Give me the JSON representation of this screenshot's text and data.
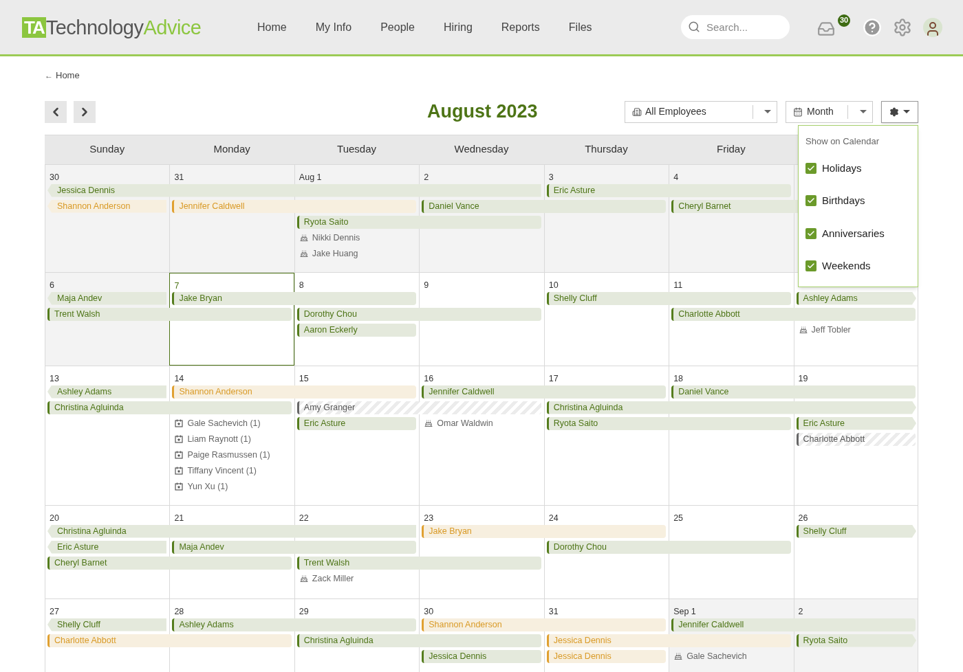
{
  "logo": {
    "mark": "TA",
    "word_1": "Technology",
    "word_2": "Advice"
  },
  "nav": [
    {
      "label": "Home",
      "selected": false
    },
    {
      "label": "My Info",
      "selected": false
    },
    {
      "label": "People",
      "selected": false
    },
    {
      "label": "Hiring",
      "selected": false
    },
    {
      "label": "Reports",
      "selected": false
    },
    {
      "label": "Files",
      "selected": false
    }
  ],
  "search": {
    "placeholder": "Search..."
  },
  "inbox_badge": "30",
  "breadcrumb": {
    "arrow": "←",
    "label": "Home"
  },
  "title": "August 2023",
  "filters": {
    "employees": "All Employees",
    "view": "Month"
  },
  "settings_menu": {
    "heading": "Show on Calendar",
    "options": [
      {
        "label": "Holidays",
        "checked": true
      },
      {
        "label": "Birthdays",
        "checked": true
      },
      {
        "label": "Anniversaries",
        "checked": true
      },
      {
        "label": "Weekends",
        "checked": true
      }
    ]
  },
  "weekdays": [
    "Sunday",
    "Monday",
    "Tuesday",
    "Wednesday",
    "Thursday",
    "Friday"
  ],
  "weeks": [
    {
      "days": [
        {
          "label": "30",
          "shaded": true,
          "today": false
        },
        {
          "label": "31",
          "shaded": true,
          "today": false
        },
        {
          "label": "Aug 1",
          "shaded": true,
          "today": false
        },
        {
          "label": "2",
          "shaded": true,
          "today": false
        },
        {
          "label": "3",
          "shaded": true,
          "today": false
        },
        {
          "label": "4",
          "shaded": true,
          "today": false
        },
        {
          "shaded": true,
          "today": false
        }
      ],
      "lanes": [
        [
          {
            "kind": "approved",
            "name": "Jessica Dennis",
            "continues_before": true,
            "continues_after": false
          },
          {
            "kind": "continue"
          },
          {
            "kind": "continue"
          },
          {
            "kind": "continue"
          },
          {
            "kind": "approved",
            "name": "Eric Asture",
            "continues_before": false,
            "continues_after": false
          },
          {
            "kind": "continue"
          },
          {
            "kind": "free"
          }
        ],
        [
          {
            "kind": "pending",
            "name": "Shannon Anderson",
            "continues_before": true,
            "continues_after": false
          },
          {
            "kind": "pending",
            "name": "Jennifer Caldwell",
            "continues_before": false,
            "continues_after": false
          },
          {
            "kind": "continue"
          },
          {
            "kind": "approved",
            "name": "Daniel Vance",
            "continues_before": false,
            "continues_after": false
          },
          {
            "kind": "continue"
          },
          {
            "kind": "approved",
            "name": "Cheryl Barnet",
            "continues_before": false,
            "continues_after": false
          },
          {
            "kind": "continue"
          }
        ],
        [
          {
            "kind": "free"
          },
          {
            "kind": "free"
          },
          {
            "kind": "approved",
            "name": "Ryota Saito",
            "continues_before": false,
            "continues_after": false
          },
          {
            "kind": "continue"
          },
          {
            "kind": "free"
          },
          {
            "kind": "free"
          },
          {
            "kind": "free"
          }
        ],
        [
          {
            "kind": "free"
          },
          {
            "kind": "free"
          },
          {
            "kind": "birthday",
            "name": "Nikki Dennis"
          },
          {
            "kind": "free"
          },
          {
            "kind": "free"
          },
          {
            "kind": "free"
          },
          {
            "kind": "free"
          }
        ],
        [
          {
            "kind": "free"
          },
          {
            "kind": "free"
          },
          {
            "kind": "birthday",
            "name": "Jake Huang"
          },
          {
            "kind": "free"
          },
          {
            "kind": "free"
          },
          {
            "kind": "free"
          },
          {
            "kind": "free"
          }
        ]
      ]
    },
    {
      "days": [
        {
          "label": "6",
          "shaded": true,
          "today": false
        },
        {
          "label": "7",
          "shaded": false,
          "today": true
        },
        {
          "label": "8",
          "shaded": false,
          "today": false
        },
        {
          "label": "9",
          "shaded": false,
          "today": false
        },
        {
          "label": "10",
          "shaded": false,
          "today": false
        },
        {
          "label": "11",
          "shaded": false,
          "today": false
        },
        {
          "shaded": false,
          "today": false
        }
      ],
      "lanes": [
        [
          {
            "kind": "approved",
            "name": "Maja Andev",
            "continues_before": true,
            "continues_after": false
          },
          {
            "kind": "approved",
            "name": "Jake Bryan",
            "continues_before": false,
            "continues_after": false
          },
          {
            "kind": "continue"
          },
          {
            "kind": "free"
          },
          {
            "kind": "approved",
            "name": "Shelly Cluff",
            "continues_before": false,
            "continues_after": false
          },
          {
            "kind": "continue"
          },
          {
            "kind": "approved",
            "name": "Ashley Adams",
            "continues_before": false,
            "continues_after": true
          }
        ],
        [
          {
            "kind": "approved",
            "name": "Trent Walsh",
            "continues_before": false,
            "continues_after": false
          },
          {
            "kind": "continue"
          },
          {
            "kind": "approved",
            "name": "Dorothy Chou",
            "continues_before": false,
            "continues_after": false
          },
          {
            "kind": "continue"
          },
          {
            "kind": "free"
          },
          {
            "kind": "approved",
            "name": "Charlotte Abbott",
            "continues_before": false,
            "continues_after": false
          },
          {
            "kind": "continue"
          }
        ],
        [
          {
            "kind": "free"
          },
          {
            "kind": "free"
          },
          {
            "kind": "approved",
            "name": "Aaron Eckerly",
            "continues_before": false,
            "continues_after": false
          },
          {
            "kind": "free"
          },
          {
            "kind": "free"
          },
          {
            "kind": "free"
          },
          {
            "kind": "birthday",
            "name": "Jeff Tobler"
          }
        ]
      ]
    },
    {
      "days": [
        {
          "label": "13",
          "shaded": false,
          "today": false
        },
        {
          "label": "14",
          "shaded": false,
          "today": false
        },
        {
          "label": "15",
          "shaded": false,
          "today": false
        },
        {
          "label": "16",
          "shaded": false,
          "today": false
        },
        {
          "label": "17",
          "shaded": false,
          "today": false
        },
        {
          "label": "18",
          "shaded": false,
          "today": false
        },
        {
          "label": "19",
          "shaded": false,
          "today": false
        }
      ],
      "lanes": [
        [
          {
            "kind": "approved",
            "name": "Ashley Adams",
            "continues_before": true,
            "continues_after": false
          },
          {
            "kind": "pending",
            "name": "Shannon Anderson",
            "continues_before": false,
            "continues_after": false
          },
          {
            "kind": "continue"
          },
          {
            "kind": "approved",
            "name": "Jennifer Caldwell",
            "continues_before": false,
            "continues_after": false
          },
          {
            "kind": "continue"
          },
          {
            "kind": "approved",
            "name": "Daniel Vance",
            "continues_before": false,
            "continues_after": false
          },
          {
            "kind": "continue"
          }
        ],
        [
          {
            "kind": "approved",
            "name": "Christina Agluinda",
            "continues_before": false,
            "continues_after": false
          },
          {
            "kind": "continue"
          },
          {
            "kind": "unpaid",
            "name": "Amy Granger",
            "continues_before": false,
            "continues_after": false
          },
          {
            "kind": "continue"
          },
          {
            "kind": "approved",
            "name": "Christina Agluinda",
            "continues_before": false,
            "continues_after": true
          },
          {
            "kind": "continue"
          },
          {
            "kind": "continue"
          }
        ],
        [
          {
            "kind": "free"
          },
          {
            "kind": "anniversary",
            "name": "Gale Sachevich (1)"
          },
          {
            "kind": "approved",
            "name": "Eric Asture",
            "continues_before": false,
            "continues_after": false
          },
          {
            "kind": "birthday",
            "name": "Omar Waldwin"
          },
          {
            "kind": "approved",
            "name": "Ryota Saito",
            "continues_before": false,
            "continues_after": false
          },
          {
            "kind": "continue"
          },
          {
            "kind": "approved",
            "name": "Eric Asture",
            "continues_before": false,
            "continues_after": true
          }
        ],
        [
          {
            "kind": "free"
          },
          {
            "kind": "anniversary",
            "name": "Liam Raynott (1)"
          },
          {
            "kind": "free"
          },
          {
            "kind": "free"
          },
          {
            "kind": "free"
          },
          {
            "kind": "free"
          },
          {
            "kind": "unpaid",
            "name": "Charlotte Abbott",
            "continues_before": false,
            "continues_after": false
          }
        ],
        [
          {
            "kind": "free"
          },
          {
            "kind": "anniversary",
            "name": "Paige Rasmussen (1)"
          },
          {
            "kind": "free"
          },
          {
            "kind": "free"
          },
          {
            "kind": "free"
          },
          {
            "kind": "free"
          },
          {
            "kind": "free"
          }
        ],
        [
          {
            "kind": "free"
          },
          {
            "kind": "anniversary",
            "name": "Tiffany Vincent (1)"
          },
          {
            "kind": "free"
          },
          {
            "kind": "free"
          },
          {
            "kind": "free"
          },
          {
            "kind": "free"
          },
          {
            "kind": "free"
          }
        ],
        [
          {
            "kind": "free"
          },
          {
            "kind": "anniversary",
            "name": "Yun Xu (1)"
          },
          {
            "kind": "free"
          },
          {
            "kind": "free"
          },
          {
            "kind": "free"
          },
          {
            "kind": "free"
          },
          {
            "kind": "free"
          }
        ]
      ]
    },
    {
      "days": [
        {
          "label": "20",
          "shaded": false,
          "today": false
        },
        {
          "label": "21",
          "shaded": false,
          "today": false
        },
        {
          "label": "22",
          "shaded": false,
          "today": false
        },
        {
          "label": "23",
          "shaded": false,
          "today": false
        },
        {
          "label": "24",
          "shaded": false,
          "today": false
        },
        {
          "label": "25",
          "shaded": false,
          "today": false
        },
        {
          "label": "26",
          "shaded": false,
          "today": false
        }
      ],
      "lanes": [
        [
          {
            "kind": "approved",
            "name": "Christina Agluinda",
            "continues_before": true,
            "continues_after": false
          },
          {
            "kind": "continue"
          },
          {
            "kind": "continue"
          },
          {
            "kind": "pending",
            "name": "Jake Bryan",
            "continues_before": false,
            "continues_after": false
          },
          {
            "kind": "continue"
          },
          {
            "kind": "free"
          },
          {
            "kind": "approved",
            "name": "Shelly Cluff",
            "continues_before": false,
            "continues_after": true
          }
        ],
        [
          {
            "kind": "approved",
            "name": "Eric Asture",
            "continues_before": true,
            "continues_after": false
          },
          {
            "kind": "approved",
            "name": "Maja Andev",
            "continues_before": false,
            "continues_after": false
          },
          {
            "kind": "continue"
          },
          {
            "kind": "free"
          },
          {
            "kind": "approved",
            "name": "Dorothy Chou",
            "continues_before": false,
            "continues_after": false
          },
          {
            "kind": "continue"
          },
          {
            "kind": "free"
          }
        ],
        [
          {
            "kind": "approved",
            "name": "Cheryl Barnet",
            "continues_before": false,
            "continues_after": false
          },
          {
            "kind": "continue"
          },
          {
            "kind": "approved",
            "name": "Trent Walsh",
            "continues_before": false,
            "continues_after": false
          },
          {
            "kind": "continue"
          },
          {
            "kind": "free"
          },
          {
            "kind": "free"
          },
          {
            "kind": "free"
          }
        ],
        [
          {
            "kind": "free"
          },
          {
            "kind": "free"
          },
          {
            "kind": "birthday",
            "name": "Zack Miller"
          },
          {
            "kind": "free"
          },
          {
            "kind": "free"
          },
          {
            "kind": "free"
          },
          {
            "kind": "free"
          }
        ]
      ]
    },
    {
      "days": [
        {
          "label": "27",
          "shaded": false,
          "today": false
        },
        {
          "label": "28",
          "shaded": false,
          "today": false
        },
        {
          "label": "29",
          "shaded": false,
          "today": false
        },
        {
          "label": "30",
          "shaded": false,
          "today": false
        },
        {
          "label": "31",
          "shaded": false,
          "today": false
        },
        {
          "label": "Sep 1",
          "shaded": true,
          "today": false
        },
        {
          "label": "2",
          "shaded": true,
          "today": false
        }
      ],
      "lanes": [
        [
          {
            "kind": "approved",
            "name": "Shelly Cluff",
            "continues_before": true,
            "continues_after": false
          },
          {
            "kind": "approved",
            "name": "Ashley Adams",
            "continues_before": false,
            "continues_after": false
          },
          {
            "kind": "continue"
          },
          {
            "kind": "pending",
            "name": "Shannon Anderson",
            "continues_before": false,
            "continues_after": false
          },
          {
            "kind": "continue"
          },
          {
            "kind": "approved",
            "name": "Jennifer Caldwell",
            "continues_before": false,
            "continues_after": false
          },
          {
            "kind": "continue"
          }
        ],
        [
          {
            "kind": "pending",
            "name": "Charlotte Abbott",
            "continues_before": false,
            "continues_after": false
          },
          {
            "kind": "continue"
          },
          {
            "kind": "approved",
            "name": "Christina Agluinda",
            "continues_before": false,
            "continues_after": false
          },
          {
            "kind": "continue"
          },
          {
            "kind": "pending",
            "name": "Jessica Dennis",
            "continues_before": false,
            "continues_after": false
          },
          {
            "kind": "continue"
          },
          {
            "kind": "approved",
            "name": "Ryota Saito",
            "continues_before": false,
            "continues_after": true
          }
        ],
        [
          {
            "kind": "free"
          },
          {
            "kind": "free"
          },
          {
            "kind": "free"
          },
          {
            "kind": "approved",
            "name": "Jessica Dennis",
            "continues_before": false,
            "continues_after": false
          },
          {
            "kind": "pending",
            "name": "Jessica Dennis",
            "continues_before": false,
            "continues_after": false
          },
          {
            "kind": "birthday",
            "name": "Gale Sachevich"
          },
          {
            "kind": "free"
          }
        ]
      ]
    }
  ]
}
